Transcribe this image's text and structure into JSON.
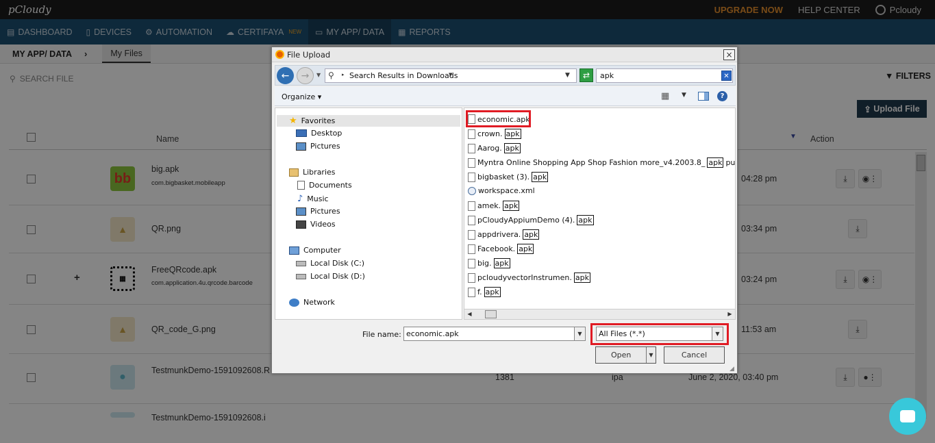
{
  "header": {
    "logo": "pCloudy",
    "upgrade": "UPGRADE NOW",
    "help_center": "HELP CENTER",
    "user": "Pcloudy"
  },
  "nav": {
    "items": [
      {
        "label": "DASHBOARD",
        "icon": "dashboard-icon"
      },
      {
        "label": "DEVICES",
        "icon": "device-icon"
      },
      {
        "label": "AUTOMATION",
        "icon": "gears-icon"
      },
      {
        "label": "CERTIFAYA",
        "badge": "NEW",
        "icon": "cloud-icon"
      },
      {
        "label": "MY APP/ DATA",
        "icon": "folder-icon"
      },
      {
        "label": "REPORTS",
        "icon": "report-icon"
      }
    ]
  },
  "breadcrumb": {
    "root": "MY APP/ DATA",
    "tab": "My Files"
  },
  "toolbar": {
    "search_placeholder": "SEARCH FILE",
    "filters": "FILTERS",
    "upload": "Upload File"
  },
  "table": {
    "headers": {
      "name": "Name",
      "action": "Action"
    },
    "rows": [
      {
        "name": "big.apk",
        "package": "com.bigbasket.mobileapp",
        "date": "04:28 pm"
      },
      {
        "name": "QR.png",
        "package": "",
        "date": "03:34 pm"
      },
      {
        "name": "FreeQRcode.apk",
        "package": "com.application.4u.qrcode.barcode",
        "date": "03:24 pm"
      },
      {
        "name": "QR_code_G.png",
        "package": "",
        "date": "11:53 am"
      },
      {
        "name": "TestmunkDemo-1591092608.R",
        "package": "",
        "size": "1381",
        "type": "ipa",
        "date": "June 2, 2020, 03:40 pm"
      },
      {
        "name": "TestmunkDemo-1591092608.i",
        "package": "",
        "date": ""
      }
    ]
  },
  "dialog": {
    "title": "File Upload",
    "close": "×",
    "path": "Search Results in Downloads",
    "search_value": "apk",
    "organize": "Organize",
    "help": "?",
    "nav": {
      "favorites": "Favorites",
      "desktop": "Desktop",
      "pictures": "Pictures",
      "libraries": "Libraries",
      "documents": "Documents",
      "music": "Music",
      "pictures2": "Pictures",
      "videos": "Videos",
      "computer": "Computer",
      "disk_c": "Local Disk (C:)",
      "disk_d": "Local Disk (D:)",
      "network": "Network"
    },
    "files": [
      {
        "base": "economic.apk",
        "ext": ""
      },
      {
        "base": "crown.",
        "ext": "apk"
      },
      {
        "base": "Aarog.",
        "ext": "apk"
      },
      {
        "base": "Myntra Online Shopping App Shop Fashion more_v4.2003.8_",
        "ext": "apk",
        "tail": "pure.com.xapk"
      },
      {
        "base": "bigbasket (3).",
        "ext": "apk"
      },
      {
        "base": "workspace.xml",
        "ext": ""
      },
      {
        "base": "amek.",
        "ext": "apk"
      },
      {
        "base": "pCloudyAppiumDemo (4).",
        "ext": "apk"
      },
      {
        "base": "appdrivera.",
        "ext": "apk"
      },
      {
        "base": "Facebook.",
        "ext": "apk"
      },
      {
        "base": "big.",
        "ext": "apk"
      },
      {
        "base": "pcloudyvectorInstrumen.",
        "ext": "apk"
      },
      {
        "base": "f.",
        "ext": "apk"
      }
    ],
    "file_name_label": "File name:",
    "file_name_value": "economic.apk",
    "file_type": "All Files (*.*)",
    "open": "Open",
    "cancel": "Cancel"
  },
  "colors": {
    "nav_bg": "#1b4f72",
    "upgrade": "#e8912d",
    "highlight_red": "#e01b24",
    "chat": "#38c8da"
  }
}
